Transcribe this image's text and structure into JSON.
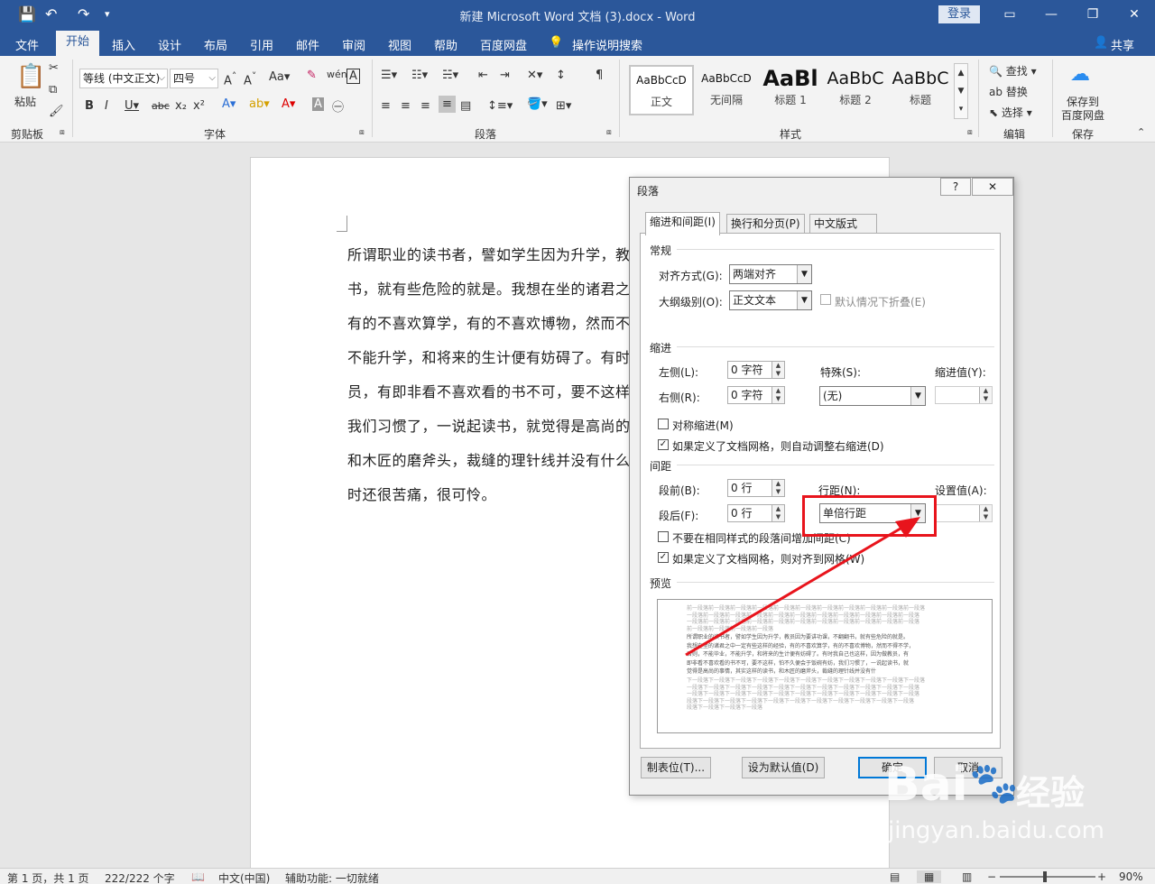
{
  "titlebar": {
    "title": "新建 Microsoft Word 文档 (3).docx  -  Word",
    "login_label": "登录",
    "save_icon": "💾",
    "undo_icon": "↶",
    "redo_icon": "↷",
    "customize_icon": "▾",
    "ribbon_display_icon": "▭",
    "minimize_icon": "—",
    "restore_icon": "❐",
    "close_icon": "✕"
  },
  "menubar": {
    "tabs": [
      "文件",
      "开始",
      "插入",
      "设计",
      "布局",
      "引用",
      "邮件",
      "审阅",
      "视图",
      "帮助",
      "百度网盘"
    ],
    "tell_me": "操作说明搜索",
    "share": "共享"
  },
  "ribbon": {
    "clipboard": {
      "label": "剪贴板",
      "paste": "粘贴"
    },
    "font": {
      "label": "字体",
      "font_name": "等线 (中文正文)",
      "font_size": "四号"
    },
    "paragraph": {
      "label": "段落"
    },
    "styles": {
      "label": "样式",
      "items": [
        {
          "sample": "AaBbCcD",
          "name": "正文"
        },
        {
          "sample": "AaBbCcD",
          "name": "无间隔"
        },
        {
          "sample": "AaBl",
          "name": "标题 1"
        },
        {
          "sample": "AaBbC",
          "name": "标题 2"
        },
        {
          "sample": "AaBbC",
          "name": "标题"
        }
      ]
    },
    "editing": {
      "label": "编辑",
      "find": "查找",
      "replace": "替换",
      "select": "选择"
    },
    "save": {
      "label": "保存",
      "save_to": "保存到",
      "baidu": "百度网盘"
    }
  },
  "document": {
    "lines": [
      "所谓职业的读书者，譬如学生因为升学，教",
      "书，就有些危险的就是。我想在坐的诸君之",
      "有的不喜欢算学，有的不喜欢博物，然而不得",
      "不能升学，和将来的生计便有妨碍了。有时",
      "员，有即非看不喜欢看的书不可，要不这样，",
      "我们习惯了，一说起读书，就觉得是高尚的",
      "和木匠的磨斧头，裁缝的理针线并没有什么",
      "时还很苦痛，很可怜。"
    ]
  },
  "statusbar": {
    "page": "第 1 页，共 1 页",
    "words": "222/222 个字",
    "language": "中文(中国)",
    "accessibility": "辅助功能: 一切就绪",
    "zoom": "90%"
  },
  "dialog": {
    "title": "段落",
    "help": "?",
    "close": "✕",
    "tabs": [
      "缩进和间距(I)",
      "换行和分页(P)",
      "中文版式(H)"
    ],
    "general": {
      "section": "常规",
      "alignment_label": "对齐方式(G):",
      "alignment_value": "两端对齐",
      "outline_label": "大纲级别(O):",
      "outline_value": "正文文本",
      "collapse_label": "默认情况下折叠(E)"
    },
    "indent": {
      "section": "缩进",
      "left_label": "左侧(L):",
      "left_value": "0 字符",
      "right_label": "右侧(R):",
      "right_value": "0 字符",
      "special_label": "特殊(S):",
      "special_value": "(无)",
      "indent_by_label": "缩进值(Y):",
      "mirror_label": "对称缩进(M)",
      "auto_adjust_label": "如果定义了文档网格，则自动调整右缩进(D)"
    },
    "spacing": {
      "section": "间距",
      "before_label": "段前(B):",
      "before_value": "0 行",
      "after_label": "段后(F):",
      "after_value": "0 行",
      "line_spacing_label": "行距(N):",
      "line_spacing_value": "单倍行距",
      "at_label": "设置值(A):",
      "no_space_label": "不要在相同样式的段落间增加间距(C)",
      "snap_grid_label": "如果定义了文档网格，则对齐到网格(W)"
    },
    "preview": {
      "section": "预览",
      "prev_lines": [
        "前一段落前一段落前一段落前一段落前一段落前一段落前一段落前一段落前一段落前一段落前一段落",
        "一段落前一段落前一段落前一段落前一段落前一段落前一段落前一段落前一段落前一段落前一段落",
        "一段落前一段落前一段落前一段落前一段落前一段落前一段落前一段落前一段落前一段落前一段落",
        "前一段落前一段落前一段落前一段落"
      ],
      "sample_lines": [
        "所谓职业的读书者，譬如学生因为升学，教员因为要讲功课，不翻翻书，就有些危险的就是。",
        "我想在坐的诸君之中一定有些这样的经验，有的不喜欢算学，有的不喜欢博物，然而不得不学，",
        "否则，不能毕业，不能升学，和将来的生计便有妨碍了。有时我自己也这样，因为做教员，有",
        "即非看不喜欢看的书不可，要不这样，怕不久便会于饭碗有妨，我们习惯了，一说起读书，就",
        "觉得是高尚的事情，其实这样的读书，和木匠的磨斧头，裁缝的理针线并没有什"
      ],
      "next_lines": [
        "下一段落下一段落下一段落下一段落下一段落下一段落下一段落下一段落下一段落下一段落下一段落",
        "一段落下一段落下一段落下一段落下一段落下一段落下一段落下一段落下一段落下一段落下一段落",
        "一段落下一段落下一段落下一段落下一段落下一段落下一段落下一段落下一段落下一段落下一段落",
        "段落下一段落下一段落下一段落下一段落下一段落下一段落下一段落下一段落下一段落下一段落",
        "段落下一段落下一段落下一段落"
      ]
    },
    "buttons": {
      "tabs": "制表位(T)...",
      "set_default": "设为默认值(D)",
      "ok": "确定",
      "cancel": "取消"
    }
  },
  "watermark": {
    "brand": "Bai",
    "brand2": "经验",
    "url": "jingyan.baidu.com"
  },
  "colors": {
    "accent": "#2b579a",
    "highlight": "#e8141c"
  }
}
